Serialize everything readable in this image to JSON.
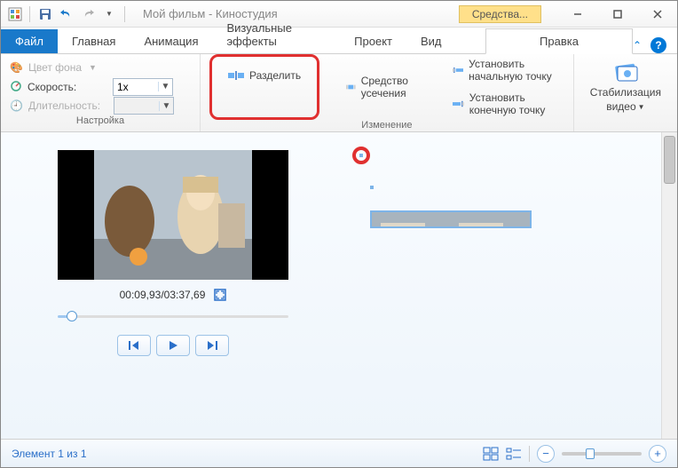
{
  "titlebar": {
    "title": "Мой фильм - Киностудия",
    "context_tab": "Средства..."
  },
  "tabs": {
    "file": "Файл",
    "items": [
      "Главная",
      "Анимация",
      "Визуальные эффекты",
      "Проект",
      "Вид"
    ],
    "context_active": "Правка"
  },
  "ribbon": {
    "settings": {
      "bg_label": "Цвет фона",
      "speed_label": "Скорость:",
      "speed_value": "1x",
      "duration_label": "Длительность:",
      "duration_value": "",
      "group_label": "Настройка"
    },
    "edit": {
      "split": "Разделить",
      "trim": "Средство усечения",
      "set_start": "Установить начальную точку",
      "set_end": "Установить конечную точку",
      "group_label": "Изменение"
    },
    "stab": {
      "label1": "Стабилизация",
      "label2": "видео"
    }
  },
  "preview": {
    "timecode": "00:09,93/03:37,69"
  },
  "status": {
    "text": "Элемент 1 из 1"
  }
}
